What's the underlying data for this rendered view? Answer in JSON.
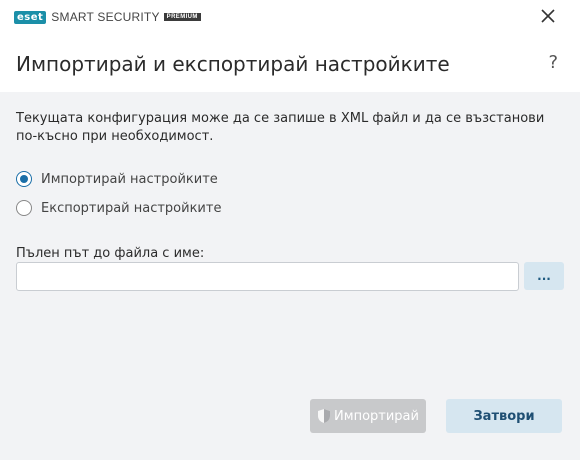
{
  "app": {
    "logo_brand": "eset",
    "product_name": "SMART SECURITY",
    "edition": "PREMIUM"
  },
  "header": {
    "title": "Импортирай и експортирай настройките",
    "help_label": "?"
  },
  "description": "Текущата конфигурация може да се запише в XML файл и да се възстанови по-късно при необходимост.",
  "options": [
    {
      "label": "Импортирай настройките",
      "checked": true
    },
    {
      "label": "Експортирай настройките",
      "checked": false
    }
  ],
  "path": {
    "label": "Пълен път до файла с име:",
    "value": "",
    "placeholder": "",
    "browse_label": "..."
  },
  "buttons": {
    "import_label": "Импортирай",
    "close_label": "Затвори"
  },
  "colors": {
    "accent": "#1b6fa8",
    "brand": "#1b8fa8",
    "button_secondary_bg": "#d6e6f0",
    "button_disabled_bg": "#c8c9cb"
  },
  "icons": {
    "close": "close-icon",
    "help": "help-icon",
    "import_button": "shield-icon"
  }
}
